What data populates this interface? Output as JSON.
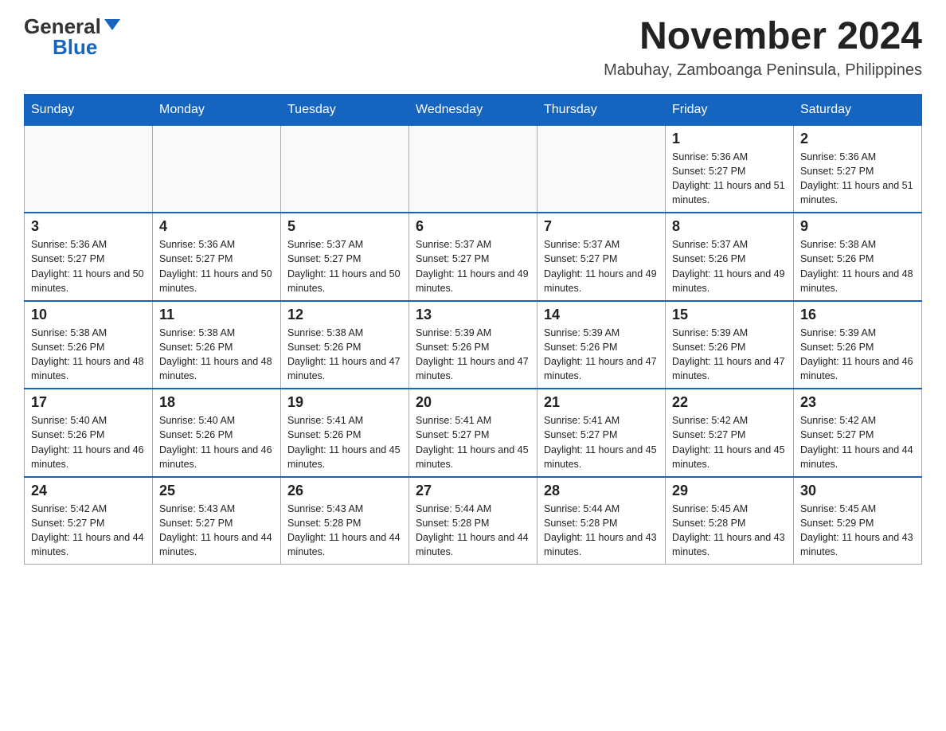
{
  "header": {
    "logo_general": "General",
    "logo_blue": "Blue",
    "main_title": "November 2024",
    "subtitle": "Mabuhay, Zamboanga Peninsula, Philippines"
  },
  "days_of_week": [
    "Sunday",
    "Monday",
    "Tuesday",
    "Wednesday",
    "Thursday",
    "Friday",
    "Saturday"
  ],
  "weeks": [
    [
      {
        "day": "",
        "info": ""
      },
      {
        "day": "",
        "info": ""
      },
      {
        "day": "",
        "info": ""
      },
      {
        "day": "",
        "info": ""
      },
      {
        "day": "",
        "info": ""
      },
      {
        "day": "1",
        "info": "Sunrise: 5:36 AM\nSunset: 5:27 PM\nDaylight: 11 hours and 51 minutes."
      },
      {
        "day": "2",
        "info": "Sunrise: 5:36 AM\nSunset: 5:27 PM\nDaylight: 11 hours and 51 minutes."
      }
    ],
    [
      {
        "day": "3",
        "info": "Sunrise: 5:36 AM\nSunset: 5:27 PM\nDaylight: 11 hours and 50 minutes."
      },
      {
        "day": "4",
        "info": "Sunrise: 5:36 AM\nSunset: 5:27 PM\nDaylight: 11 hours and 50 minutes."
      },
      {
        "day": "5",
        "info": "Sunrise: 5:37 AM\nSunset: 5:27 PM\nDaylight: 11 hours and 50 minutes."
      },
      {
        "day": "6",
        "info": "Sunrise: 5:37 AM\nSunset: 5:27 PM\nDaylight: 11 hours and 49 minutes."
      },
      {
        "day": "7",
        "info": "Sunrise: 5:37 AM\nSunset: 5:27 PM\nDaylight: 11 hours and 49 minutes."
      },
      {
        "day": "8",
        "info": "Sunrise: 5:37 AM\nSunset: 5:26 PM\nDaylight: 11 hours and 49 minutes."
      },
      {
        "day": "9",
        "info": "Sunrise: 5:38 AM\nSunset: 5:26 PM\nDaylight: 11 hours and 48 minutes."
      }
    ],
    [
      {
        "day": "10",
        "info": "Sunrise: 5:38 AM\nSunset: 5:26 PM\nDaylight: 11 hours and 48 minutes."
      },
      {
        "day": "11",
        "info": "Sunrise: 5:38 AM\nSunset: 5:26 PM\nDaylight: 11 hours and 48 minutes."
      },
      {
        "day": "12",
        "info": "Sunrise: 5:38 AM\nSunset: 5:26 PM\nDaylight: 11 hours and 47 minutes."
      },
      {
        "day": "13",
        "info": "Sunrise: 5:39 AM\nSunset: 5:26 PM\nDaylight: 11 hours and 47 minutes."
      },
      {
        "day": "14",
        "info": "Sunrise: 5:39 AM\nSunset: 5:26 PM\nDaylight: 11 hours and 47 minutes."
      },
      {
        "day": "15",
        "info": "Sunrise: 5:39 AM\nSunset: 5:26 PM\nDaylight: 11 hours and 47 minutes."
      },
      {
        "day": "16",
        "info": "Sunrise: 5:39 AM\nSunset: 5:26 PM\nDaylight: 11 hours and 46 minutes."
      }
    ],
    [
      {
        "day": "17",
        "info": "Sunrise: 5:40 AM\nSunset: 5:26 PM\nDaylight: 11 hours and 46 minutes."
      },
      {
        "day": "18",
        "info": "Sunrise: 5:40 AM\nSunset: 5:26 PM\nDaylight: 11 hours and 46 minutes."
      },
      {
        "day": "19",
        "info": "Sunrise: 5:41 AM\nSunset: 5:26 PM\nDaylight: 11 hours and 45 minutes."
      },
      {
        "day": "20",
        "info": "Sunrise: 5:41 AM\nSunset: 5:27 PM\nDaylight: 11 hours and 45 minutes."
      },
      {
        "day": "21",
        "info": "Sunrise: 5:41 AM\nSunset: 5:27 PM\nDaylight: 11 hours and 45 minutes."
      },
      {
        "day": "22",
        "info": "Sunrise: 5:42 AM\nSunset: 5:27 PM\nDaylight: 11 hours and 45 minutes."
      },
      {
        "day": "23",
        "info": "Sunrise: 5:42 AM\nSunset: 5:27 PM\nDaylight: 11 hours and 44 minutes."
      }
    ],
    [
      {
        "day": "24",
        "info": "Sunrise: 5:42 AM\nSunset: 5:27 PM\nDaylight: 11 hours and 44 minutes."
      },
      {
        "day": "25",
        "info": "Sunrise: 5:43 AM\nSunset: 5:27 PM\nDaylight: 11 hours and 44 minutes."
      },
      {
        "day": "26",
        "info": "Sunrise: 5:43 AM\nSunset: 5:28 PM\nDaylight: 11 hours and 44 minutes."
      },
      {
        "day": "27",
        "info": "Sunrise: 5:44 AM\nSunset: 5:28 PM\nDaylight: 11 hours and 44 minutes."
      },
      {
        "day": "28",
        "info": "Sunrise: 5:44 AM\nSunset: 5:28 PM\nDaylight: 11 hours and 43 minutes."
      },
      {
        "day": "29",
        "info": "Sunrise: 5:45 AM\nSunset: 5:28 PM\nDaylight: 11 hours and 43 minutes."
      },
      {
        "day": "30",
        "info": "Sunrise: 5:45 AM\nSunset: 5:29 PM\nDaylight: 11 hours and 43 minutes."
      }
    ]
  ]
}
